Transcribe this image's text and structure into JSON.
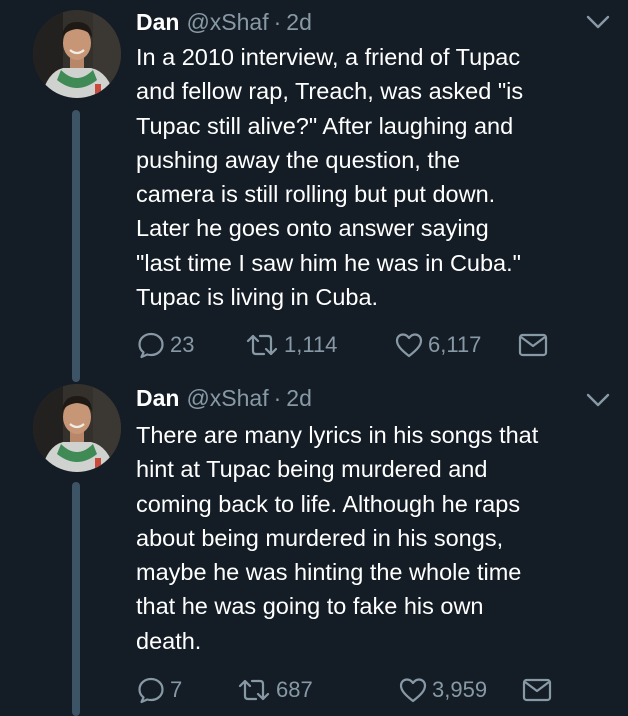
{
  "colors": {
    "background": "#141d26",
    "primary_text": "#ffffff",
    "secondary_text": "#8899a6",
    "thread_line": "#3d5466"
  },
  "tweets": [
    {
      "author_name": "Dan",
      "handle": "@xShaf",
      "separator": "·",
      "time": "2d",
      "text_lines": [
        "In a 2010 interview, a friend of Tupac",
        "and fellow rap, Treach, was asked \"is",
        "Tupac still alive?\" After laughing and",
        "pushing away the question, the",
        "camera is still rolling but put down.",
        "Later he goes onto answer saying",
        "\"last time I saw him he was in Cuba.\"",
        "Tupac is living in Cuba."
      ],
      "replies": "23",
      "retweets": "1,114",
      "likes": "6,117",
      "icons": {
        "menu": "chevron-down-icon",
        "reply": "reply-icon",
        "retweet": "retweet-icon",
        "like": "heart-icon",
        "message": "envelope-icon"
      }
    },
    {
      "author_name": "Dan",
      "handle": "@xShaf",
      "separator": "·",
      "time": "2d",
      "text_lines": [
        "There are many lyrics in his songs that",
        "hint at Tupac being murdered and",
        "coming back to life. Although he raps",
        "about being murdered in his songs,",
        "maybe he was hinting the whole time",
        "that he was going to fake his own",
        "death."
      ],
      "replies": "7",
      "retweets": "687",
      "likes": "3,959",
      "icons": {
        "menu": "chevron-down-icon",
        "reply": "reply-icon",
        "retweet": "retweet-icon",
        "like": "heart-icon",
        "message": "envelope-icon"
      }
    }
  ]
}
